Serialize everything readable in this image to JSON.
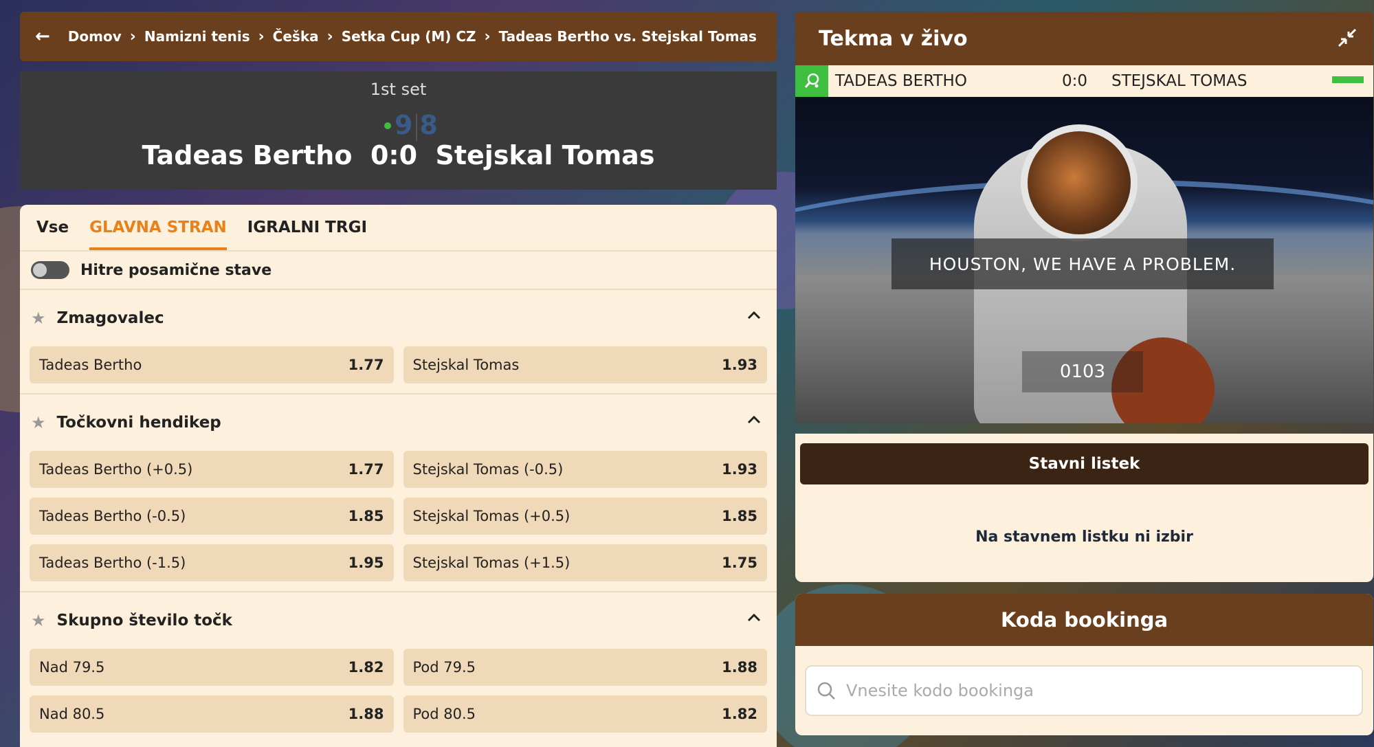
{
  "breadcrumb": {
    "items": [
      "Domov",
      "Namizni tenis",
      "Češka",
      "Setka Cup (M) CZ",
      "Tadeas Bertho vs. Stejskal Tomas"
    ]
  },
  "score_header": {
    "set_label": "1st set",
    "mini_home": "9",
    "mini_away": "8",
    "home": "Tadeas Bertho",
    "score": "0:0",
    "away": "Stejskal Tomas"
  },
  "tabs": [
    {
      "label": "Vse",
      "active": false
    },
    {
      "label": "GLAVNA STRAN",
      "active": true
    },
    {
      "label": "IGRALNI TRGI",
      "active": false
    }
  ],
  "quick_bets": {
    "label": "Hitre posamične stave",
    "enabled": false
  },
  "markets": [
    {
      "title": "Zmagovalec",
      "rows": [
        [
          {
            "label": "Tadeas Bertho",
            "price": "1.77"
          },
          {
            "label": "Stejskal Tomas",
            "price": "1.93"
          }
        ]
      ]
    },
    {
      "title": "Točkovni hendikep",
      "rows": [
        [
          {
            "label": "Tadeas Bertho (+0.5)",
            "price": "1.77"
          },
          {
            "label": "Stejskal Tomas (-0.5)",
            "price": "1.93"
          }
        ],
        [
          {
            "label": "Tadeas Bertho (-0.5)",
            "price": "1.85"
          },
          {
            "label": "Stejskal Tomas (+0.5)",
            "price": "1.85"
          }
        ],
        [
          {
            "label": "Tadeas Bertho (-1.5)",
            "price": "1.95"
          },
          {
            "label": "Stejskal Tomas (+1.5)",
            "price": "1.75"
          }
        ]
      ]
    },
    {
      "title": "Skupno število točk",
      "rows": [
        [
          {
            "label": "Nad 79.5",
            "price": "1.82"
          },
          {
            "label": "Pod 79.5",
            "price": "1.88"
          }
        ],
        [
          {
            "label": "Nad 80.5",
            "price": "1.88"
          },
          {
            "label": "Pod 80.5",
            "price": "1.82"
          }
        ]
      ]
    }
  ],
  "live": {
    "title": "Tekma v živo",
    "home": "TADEAS BERTHO",
    "score": "0:0",
    "away": "STEJSKAL TOMAS",
    "video_caption": "HOUSTON, WE HAVE A PROBLEM.",
    "video_code": "0103"
  },
  "betslip": {
    "title": "Stavni listek",
    "empty_text": "Na stavnem listku ni izbir"
  },
  "booking": {
    "title": "Koda bookinga",
    "placeholder": "Vnesite kodo bookinga",
    "value": ""
  },
  "colors": {
    "accent": "#e8811a",
    "brown": "#6a3f1e",
    "panel": "#fdf0dc",
    "odd_bg": "#f0d9b8",
    "live_green": "#3fbf3f"
  }
}
